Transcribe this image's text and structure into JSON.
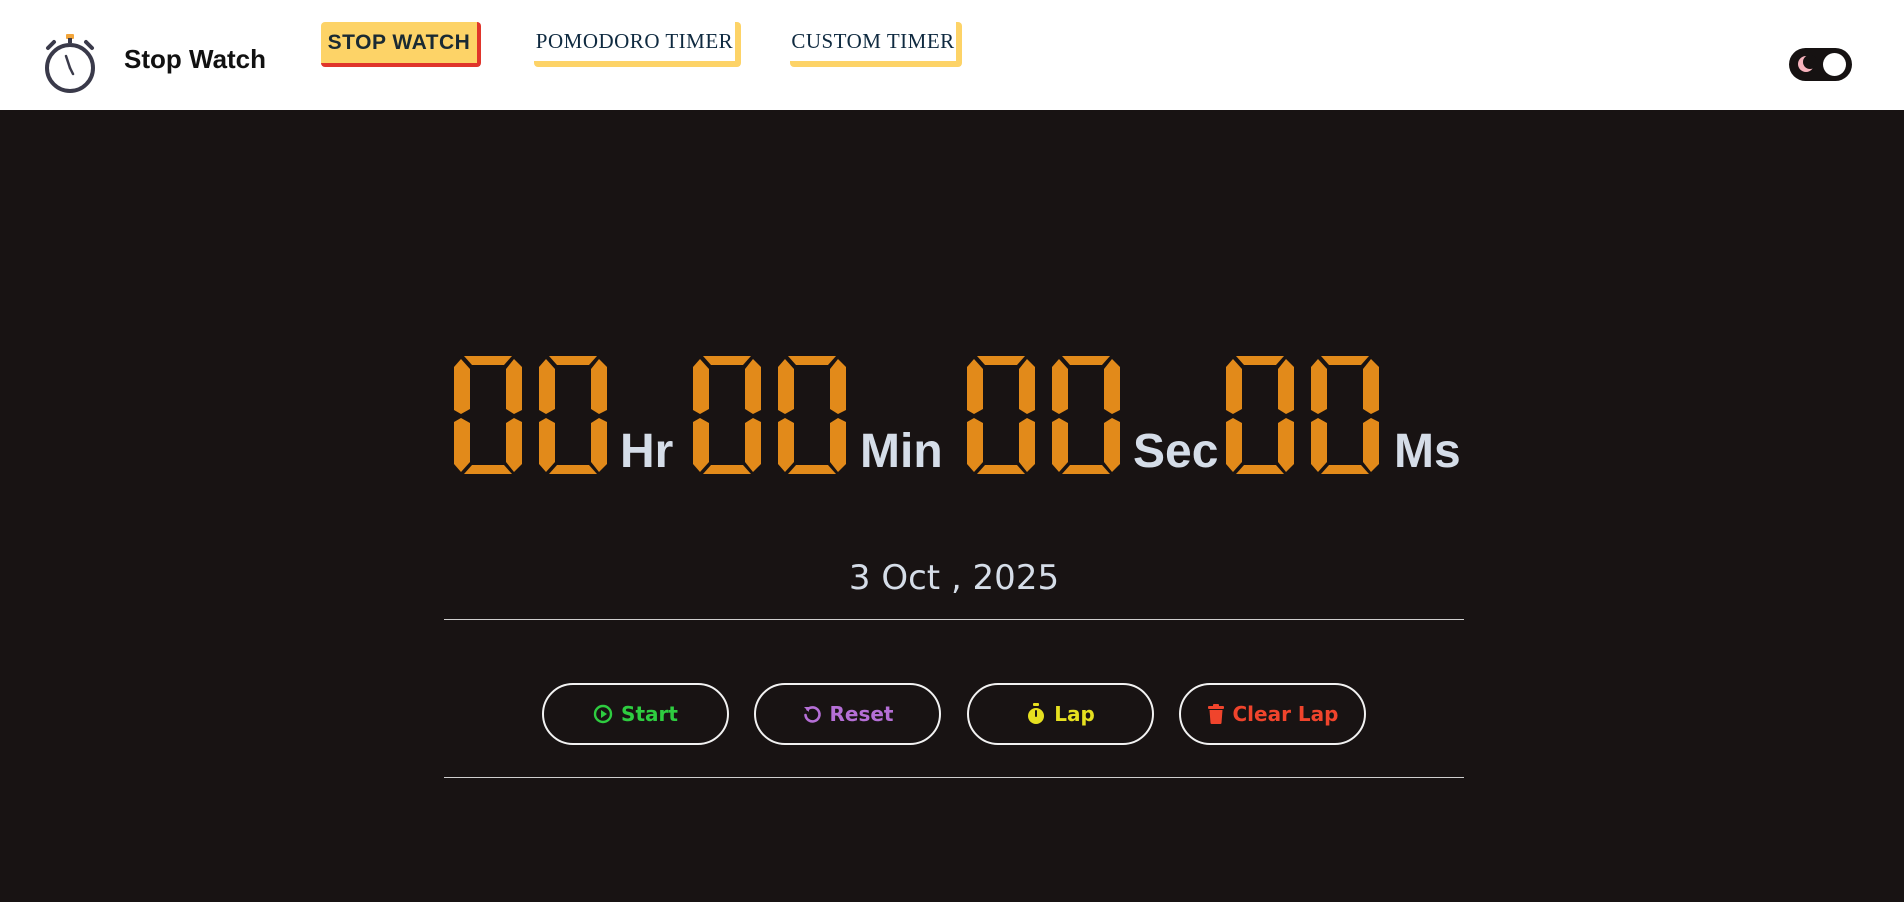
{
  "header": {
    "brand": "Stop Watch",
    "logo_icon": "stopwatch-icon",
    "nav": [
      {
        "label": "STOP WATCH",
        "active": true
      },
      {
        "label": "POMODORO TIMER",
        "active": false
      },
      {
        "label": "CUSTOM TIMER",
        "active": false
      }
    ],
    "theme_toggle": {
      "icon": "moon-icon",
      "state": "on"
    }
  },
  "display": {
    "hours": "00",
    "minutes": "00",
    "seconds": "00",
    "milliseconds": "00",
    "units": {
      "hours": "Hr",
      "minutes": "Min",
      "seconds": "Sec",
      "milliseconds": "Ms"
    },
    "digit_color": "#e28a1a"
  },
  "date": "3 Oct , 2025",
  "controls": {
    "start": {
      "label": "Start",
      "icon": "play-circle-icon",
      "color": "#2ecc40"
    },
    "reset": {
      "label": "Reset",
      "icon": "undo-icon",
      "color": "#b56fd6"
    },
    "lap": {
      "label": "Lap",
      "icon": "stopwatch-icon",
      "color": "#e6e020"
    },
    "clear_lap": {
      "label": "Clear Lap",
      "icon": "trash-icon",
      "color": "#f0442c"
    }
  },
  "colors": {
    "accent": "#fdd367",
    "accent_shadow": "#e0352b",
    "background": "#181313",
    "header_bg": "#ffffff"
  }
}
